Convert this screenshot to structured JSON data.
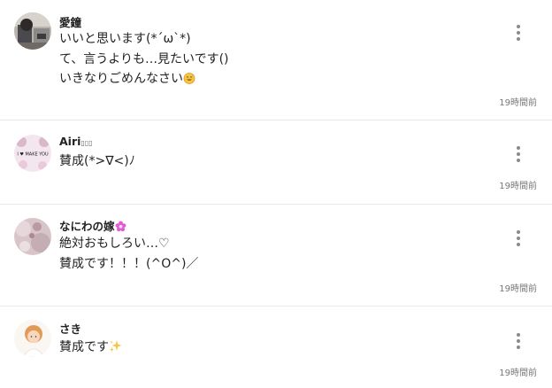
{
  "comments": [
    {
      "username": "愛鐘",
      "lines": [
        "いいと思います(*´ω`*)",
        "て、言うよりも…見たいです()",
        "いきなりごめんなさい"
      ],
      "trailing_icon": "sweat-smile-emoji",
      "time": "19時間前"
    },
    {
      "username": "Airi",
      "username_suffix": "▯▯▯",
      "lines": [
        "賛成(*>∇<)ﾉ"
      ],
      "avatar_text": "I ♥ MAKE YOU",
      "time": "19時間前"
    },
    {
      "username": "なにわの嫁",
      "username_icon": "flower-emoji",
      "lines": [
        "絶対おもしろい…♡",
        "賛成です！！！(^O^)／"
      ],
      "time": "19時間前"
    },
    {
      "username": "さき",
      "lines": [
        "賛成です"
      ],
      "trailing_icon": "sparkles-emoji",
      "time": "19時間前"
    }
  ],
  "colors": {
    "divider": "#e8e8e8",
    "time_text": "#777777",
    "menu_dots": "#8a8a8a",
    "flower": "#e35bd6",
    "sparkle": "#f5c542",
    "sweat_smile": "#f5c542"
  }
}
